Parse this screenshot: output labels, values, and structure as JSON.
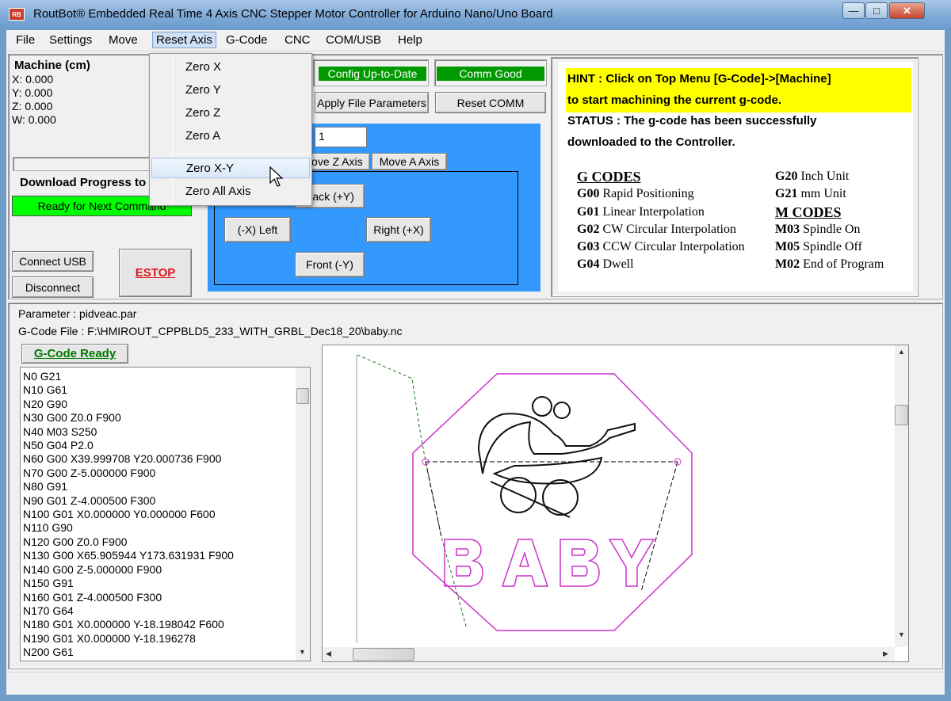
{
  "window": {
    "title": "RoutBot® Embedded Real Time 4 Axis CNC Stepper Motor Controller for Arduino Nano/Uno Board",
    "icon_text": "RB",
    "controls": [
      "minimize-icon",
      "maximize-icon",
      "close-icon"
    ]
  },
  "menu": {
    "items": [
      "File",
      "Settings",
      "Move",
      "Reset Axis",
      "G-Code",
      "CNC",
      "COM/USB",
      "Help"
    ],
    "open": "Reset Axis"
  },
  "dropdown": {
    "items": [
      "Zero X",
      "Zero Y",
      "Zero Z",
      "Zero A",
      "Zero X-Y",
      "Zero All Axis"
    ],
    "highlighted": "Zero X-Y"
  },
  "machine": {
    "title": "Machine (cm)",
    "x": "X: 0.000",
    "y": "Y: 0.000",
    "z": "Z: 0.000",
    "w": "W: 0.000"
  },
  "download": {
    "label": "Download Progress to",
    "status": "Ready for Next Command",
    "status_color": "#00ff00"
  },
  "usb": {
    "connect": "Connect USB",
    "disconnect": "Disconnect",
    "estop": "ESTOP"
  },
  "status_indicators": {
    "config": "Config Up-to-Date",
    "comm": "Comm Good",
    "color": "#009900"
  },
  "actions": {
    "apply_params": "Apply File Parameters",
    "reset_comm": "Reset COMM"
  },
  "jog": {
    "step_value": "1",
    "tab_z": "Move Z Axis",
    "tab_a": "Move A Axis",
    "back": "Back (+Y)",
    "left": "(-X) Left",
    "right": "Right  (+X)",
    "front": "Front (-Y)",
    "panel_color": "#3399ff"
  },
  "hint": {
    "line1": "HINT   : Click on Top Menu [G-Code]->[Machine]",
    "line2": "to start machining the current g-code.",
    "status1": "STATUS : The g-code has been successfully",
    "status2": "downloaded to the Controller.",
    "gcodes_title": "G CODES",
    "gcodes": [
      {
        "code": "G00",
        "desc": "Rapid Positioning"
      },
      {
        "code": "G01",
        "desc": "Linear Interpolation"
      },
      {
        "code": "G02",
        "desc": "CW Circular Interpolation"
      },
      {
        "code": "G03",
        "desc": "CCW Circular Interpolation"
      },
      {
        "code": "G04",
        "desc": "Dwell"
      }
    ],
    "units": [
      {
        "code": "G20",
        "desc": "Inch Unit"
      },
      {
        "code": "G21",
        "desc": "mm Unit"
      }
    ],
    "mcodes_title": "M CODES",
    "mcodes": [
      {
        "code": "M03",
        "desc": "Spindle On"
      },
      {
        "code": "M05",
        "desc": "Spindle Off"
      },
      {
        "code": "M02",
        "desc": "End of Program"
      }
    ]
  },
  "file": {
    "parameter": "Parameter : pidveac.par",
    "gcode_file": "G-Code File : F:\\HMIROUT_CPPBLD5_233_WITH_GRBL_Dec18_20\\baby.nc",
    "ready": "G-Code Ready"
  },
  "gcode_lines": [
    "N0 G21",
    "N10 G61",
    "N20 G90",
    "N30 G00 Z0.0 F900",
    "N40 M03 S250",
    "N50 G04 P2.0",
    "N60 G00 X39.999708 Y20.000736 F900",
    "N70 G00 Z-5.000000 F900",
    "N80 G91",
    "N90 G01 Z-4.000500 F300",
    "N100 G01 X0.000000 Y0.000000 F600",
    "N110 G90",
    "N120 G00 Z0.0 F900",
    "N130 G00 X65.905944 Y173.631931 F900",
    "N140 G00 Z-5.000000 F900",
    "N150 G91",
    "N160 G01 Z-4.000500 F300",
    "N170 G64",
    "N180 G01 X0.000000 Y-18.198042 F600",
    "N190 G01 X0.000000 Y-18.196278",
    "N200 G61"
  ],
  "preview": {
    "text": "BABY",
    "outline_color": "#cc33cc",
    "path_color": "#000000"
  }
}
